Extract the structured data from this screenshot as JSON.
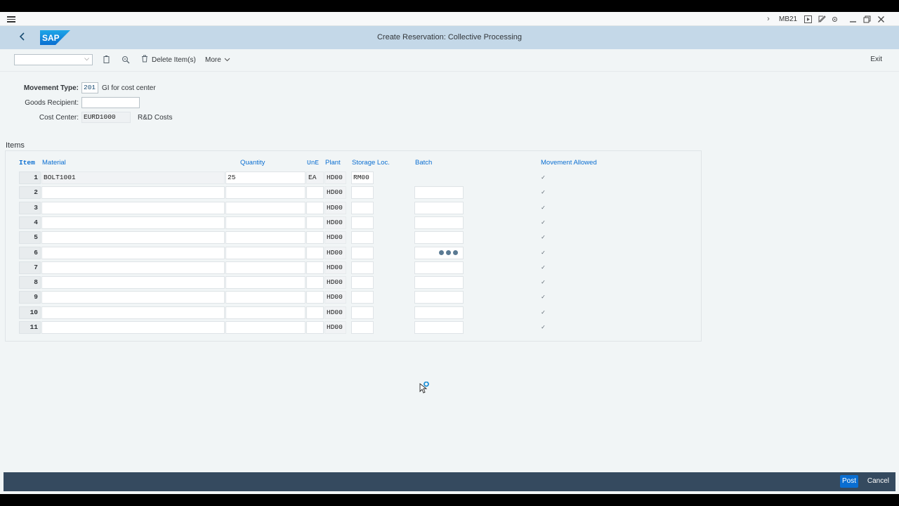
{
  "titlebar": {
    "tcode": "MB21"
  },
  "header": {
    "title": "Create Reservation: Collective Processing",
    "logo_text": "SAP"
  },
  "toolbar": {
    "variant_value": "",
    "delete_label": "Delete Item(s)",
    "more_label": "More",
    "exit_label": "Exit"
  },
  "fields": {
    "movement_type": {
      "label": "Movement Type:",
      "value": "201",
      "desc": "GI for cost center"
    },
    "goods_recipient": {
      "label": "Goods Recipient:",
      "value": ""
    },
    "cost_center": {
      "label": "Cost Center:",
      "value": "EURD1000",
      "desc": "R&D Costs"
    }
  },
  "items": {
    "title": "Items",
    "columns": {
      "item": "Item",
      "material": "Material",
      "quantity": "Quantity",
      "une": "UnE",
      "plant": "Plant",
      "storage_loc": "Storage Loc.",
      "batch": "Batch",
      "movement_allowed": "Movement Allowed"
    },
    "rows": [
      {
        "item": "1",
        "material": "BOLT1001",
        "quantity": "25",
        "une": "EA",
        "plant": "HD00",
        "storage_loc": "RM00",
        "batch": "",
        "movement_allowed": true
      },
      {
        "item": "2",
        "material": "",
        "quantity": "",
        "une": "",
        "plant": "HD00",
        "storage_loc": "",
        "batch": "",
        "movement_allowed": true
      },
      {
        "item": "3",
        "material": "",
        "quantity": "",
        "une": "",
        "plant": "HD00",
        "storage_loc": "",
        "batch": "",
        "movement_allowed": true
      },
      {
        "item": "4",
        "material": "",
        "quantity": "",
        "une": "",
        "plant": "HD00",
        "storage_loc": "",
        "batch": "",
        "movement_allowed": true
      },
      {
        "item": "5",
        "material": "",
        "quantity": "",
        "une": "",
        "plant": "HD00",
        "storage_loc": "",
        "batch": "",
        "movement_allowed": true
      },
      {
        "item": "6",
        "material": "",
        "quantity": "",
        "une": "",
        "plant": "HD00",
        "storage_loc": "",
        "batch": "",
        "movement_allowed": true
      },
      {
        "item": "7",
        "material": "",
        "quantity": "",
        "une": "",
        "plant": "HD00",
        "storage_loc": "",
        "batch": "",
        "movement_allowed": true
      },
      {
        "item": "8",
        "material": "",
        "quantity": "",
        "une": "",
        "plant": "HD00",
        "storage_loc": "",
        "batch": "",
        "movement_allowed": true
      },
      {
        "item": "9",
        "material": "",
        "quantity": "",
        "une": "",
        "plant": "HD00",
        "storage_loc": "",
        "batch": "",
        "movement_allowed": true
      },
      {
        "item": "10",
        "material": "",
        "quantity": "",
        "une": "",
        "plant": "HD00",
        "storage_loc": "",
        "batch": "",
        "movement_allowed": true
      },
      {
        "item": "11",
        "material": "",
        "quantity": "",
        "une": "",
        "plant": "HD00",
        "storage_loc": "",
        "batch": "",
        "movement_allowed": true
      }
    ]
  },
  "footer": {
    "post_label": "Post",
    "cancel_label": "Cancel"
  },
  "colors": {
    "shell": "#c4d8e8",
    "footer": "#354a5f",
    "accent": "#0a6ed1"
  }
}
